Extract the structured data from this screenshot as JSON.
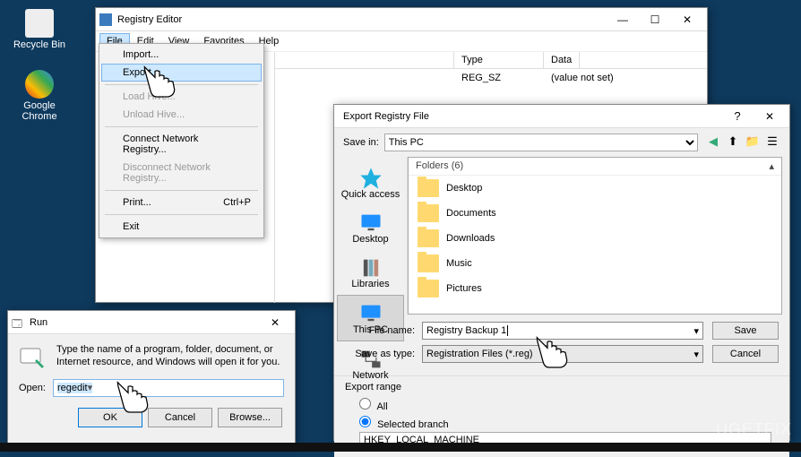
{
  "desktop": {
    "icons": [
      {
        "label": "Recycle Bin"
      },
      {
        "label": "Google Chrome"
      }
    ]
  },
  "regedit": {
    "title": "Registry Editor",
    "menus": [
      "File",
      "Edit",
      "View",
      "Favorites",
      "Help"
    ],
    "columns": {
      "type": "Type",
      "data": "Data"
    },
    "row": {
      "type": "REG_SZ",
      "data": "(value not set)"
    }
  },
  "file_menu": {
    "import": "Import...",
    "export": "Export...",
    "load_hive": "Load Hive...",
    "unload_hive": "Unload Hive...",
    "connect": "Connect Network Registry...",
    "disconnect": "Disconnect Network Registry...",
    "print": "Print...",
    "print_shortcut": "Ctrl+P",
    "exit": "Exit"
  },
  "export": {
    "title": "Export Registry File",
    "save_in_label": "Save in:",
    "save_in_value": "This PC",
    "places": {
      "quick": "Quick access",
      "desktop": "Desktop",
      "libraries": "Libraries",
      "this_pc": "This PC",
      "network": "Network"
    },
    "folder_header": "Folders (6)",
    "folders": [
      "Desktop",
      "Documents",
      "Downloads",
      "Music",
      "Pictures"
    ],
    "file_name_label": "File name:",
    "file_name_value": "Registry Backup 1",
    "save_type_label": "Save as type:",
    "save_type_value": "Registration Files (*.reg)",
    "save_btn": "Save",
    "cancel_btn": "Cancel",
    "range_title": "Export range",
    "range_all": "All",
    "range_selected": "Selected branch",
    "branch_value": "HKEY_LOCAL_MACHINE"
  },
  "run": {
    "title": "Run",
    "desc": "Type the name of a program, folder, document, or Internet resource, and Windows will open it for you.",
    "open_label": "Open:",
    "open_value": "regedit",
    "ok": "OK",
    "cancel": "Cancel",
    "browse": "Browse..."
  },
  "watermark": "UGETFIX"
}
